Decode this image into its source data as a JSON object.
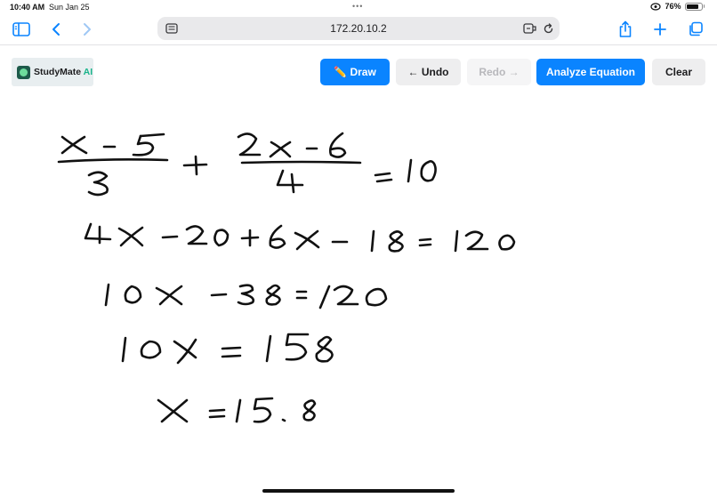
{
  "status_bar": {
    "time": "10:40 AM",
    "date": "Sun Jan 25",
    "battery": "76%"
  },
  "browser": {
    "url": "172.20.10.2"
  },
  "app": {
    "logo_name": "StudyMate",
    "logo_suffix": "AI",
    "toolbar": {
      "draw_label": "✏️ Draw",
      "undo_label": "← Undo",
      "redo_label": "Redo →",
      "analyze_label": "Analyze Equation",
      "clear_label": "Clear"
    }
  },
  "canvas": {
    "handwriting_lines": [
      "(x - 5)/3 + (2x - 6)/4 = 10",
      "4x - 20 + 6x - 18 = 120",
      "10x - 38 = 120",
      "10x = 158",
      "x = 15.8"
    ]
  },
  "colors": {
    "accent": "#0a84ff",
    "ink": "#111111",
    "logo_accent": "#19b38a"
  }
}
